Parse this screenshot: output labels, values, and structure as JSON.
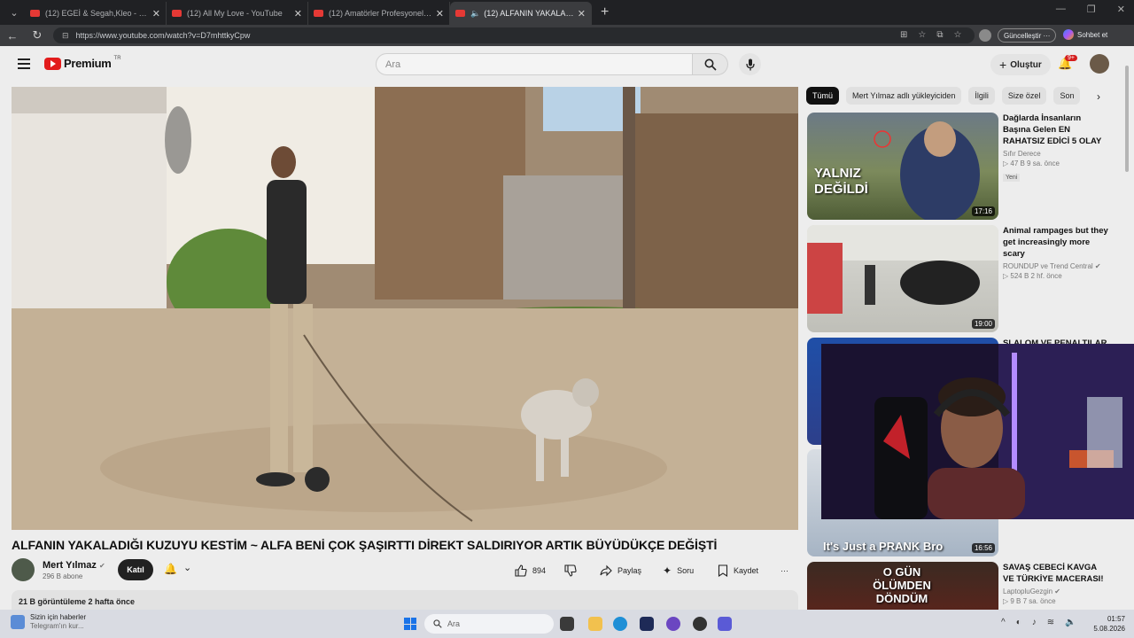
{
  "browser": {
    "tabs": [
      {
        "title": "(12) EGEİ & Segah,Kleo - SOKAKLAR...",
        "active": false
      },
      {
        "title": "(12) All My Love - YouTube",
        "active": false
      },
      {
        "title": "(12) Amatörler Profesyonel Dövüşçü...",
        "active": false
      },
      {
        "title": "(12) ALFANIN YAKALADIĞI KU...",
        "active": true
      }
    ],
    "url": "https://www.youtube.com/watch?v=D7mhttkyCpw",
    "update_label": "Güncelleştir",
    "chat_label": "Sohbet et"
  },
  "youtube": {
    "logo": "Premium",
    "logo_region": "TR",
    "search_placeholder": "Ara",
    "create_label": "Oluştur",
    "notifications_badge": "9+"
  },
  "video": {
    "title": "ALFANIN YAKALADIĞI KUZUYU KESTİM ~ ALFA BENİ ÇOK ŞAŞIRTTI DİREKT SALDIRIYOR ARTIK BÜYÜDÜKÇE DEĞİŞTİ",
    "channel": "Mert Yılmaz",
    "subscribers": "296 B abone",
    "join_label": "Katıl",
    "likes": "894",
    "share_label": "Paylaş",
    "ask_label": "Soru",
    "save_label": "Kaydet",
    "views_date": "21 B görüntüleme  2 hafta önce"
  },
  "chips": [
    "Tümü",
    "Mert Yılmaz adlı yükleyiciden",
    "İlgili",
    "Size özel",
    "Son"
  ],
  "recommendations": [
    {
      "title": "Dağlarda İnsanların Başına Gelen EN RAHATSIZ EDİCİ 5 OLAY",
      "channel": "Sıfır Derece",
      "meta": "▷ 47 B  9 sa. önce",
      "badge": "Yeni",
      "duration": "17:16",
      "thumb_text": "YALNIZ DEĞİLDİ"
    },
    {
      "title": "Animal rampages but they get increasingly more scary",
      "channel": "ROUNDUP ve Trend Central",
      "meta": "▷ 524 B  2 hf. önce",
      "badge": "",
      "duration": "19:00",
      "thumb_text": ""
    },
    {
      "title": "SLALOM VE PENALTILAR",
      "channel": "",
      "meta": "",
      "badge": "",
      "duration": "",
      "thumb_text": ""
    },
    {
      "title": "",
      "channel": "",
      "meta": "",
      "badge": "",
      "duration": "16:56",
      "thumb_text": "It's Just a PRANK Bro"
    },
    {
      "title": "SAVAŞ CEBECİ KAVGA VE TÜRKİYE MACERASI!",
      "channel": "LaptopluGezgin",
      "meta": "▷ 9 B  7 sa. önce",
      "badge": "",
      "duration": "",
      "thumb_text": "O GÜN ÖLÜMDEN DÖNDÜM"
    }
  ],
  "taskbar": {
    "news_title": "Sizin için haberler",
    "news_sub": "Telegram'ın kur...",
    "search_placeholder": "Ara",
    "time": "01:57",
    "date": "5.08.2026"
  }
}
